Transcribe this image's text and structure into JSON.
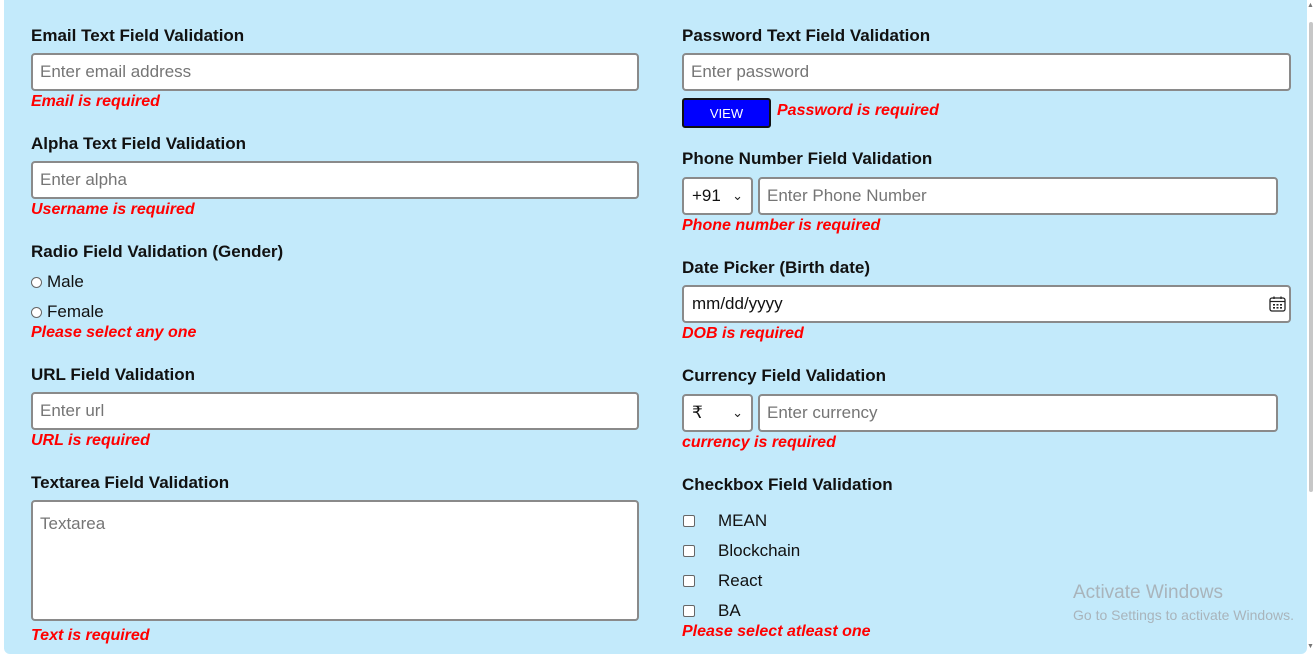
{
  "email": {
    "label": "Email Text Field Validation",
    "placeholder": "Enter email address",
    "error": "Email is required"
  },
  "alpha": {
    "label": "Alpha Text Field Validation",
    "placeholder": "Enter alpha",
    "error": "Username is required"
  },
  "gender": {
    "label": "Radio Field Validation (Gender)",
    "options": [
      "Male",
      "Female"
    ],
    "error": "Please select any one"
  },
  "url": {
    "label": "URL Field Validation",
    "placeholder": "Enter url",
    "error": "URL is required"
  },
  "textarea": {
    "label": "Textarea Field Validation",
    "placeholder": "Textarea",
    "error": "Text is required"
  },
  "password": {
    "label": "Password Text Field Validation",
    "placeholder": "Enter password",
    "view_label": "VIEW",
    "error": "Password is required"
  },
  "phone": {
    "label": "Phone Number Field Validation",
    "country_code": "+91",
    "placeholder": "Enter Phone Number",
    "error": "Phone number is required"
  },
  "dob": {
    "label": "Date Picker (Birth date)",
    "value": "mm/dd/yyyy",
    "error": "DOB is required"
  },
  "currency": {
    "label": "Currency Field Validation",
    "symbol": "₹",
    "placeholder": "Enter currency",
    "error": "currency is required"
  },
  "checkbox": {
    "label": "Checkbox Field Validation",
    "options": [
      "MEAN",
      "Blockchain",
      "React",
      "BA"
    ],
    "error": "Please select atleast one"
  },
  "watermark": {
    "title": "Activate Windows",
    "subtitle": "Go to Settings to activate Windows."
  },
  "colors": {
    "panel_bg": "#c3eafb",
    "error": "#ff0000",
    "view_button": "#0000ff"
  }
}
